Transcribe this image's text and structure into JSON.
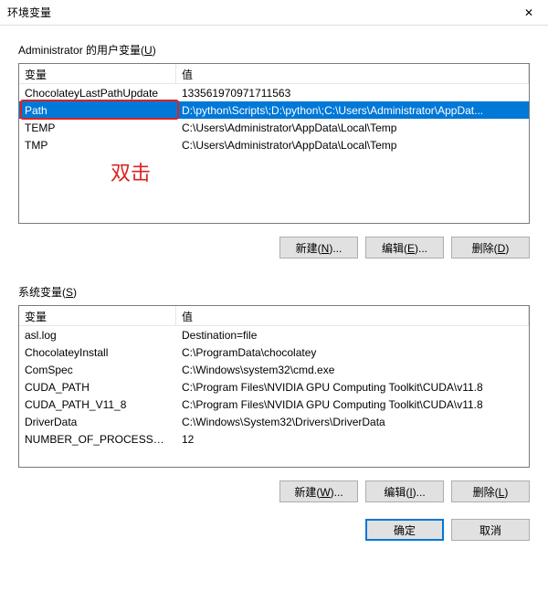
{
  "window": {
    "title": "环境变量"
  },
  "user_section": {
    "label_prefix": "Administrator 的用户变量(",
    "label_key": "U",
    "label_suffix": ")",
    "col_name": "变量",
    "col_value": "值",
    "rows": [
      {
        "name": "ChocolateyLastPathUpdate",
        "value": "133561970971711563"
      },
      {
        "name": "Path",
        "value": "D:\\python\\Scripts\\;D:\\python\\;C:\\Users\\Administrator\\AppDat..."
      },
      {
        "name": "TEMP",
        "value": "C:\\Users\\Administrator\\AppData\\Local\\Temp"
      },
      {
        "name": "TMP",
        "value": "C:\\Users\\Administrator\\AppData\\Local\\Temp"
      }
    ],
    "selected_index": 1,
    "btn_new": "新建(N)...",
    "btn_edit": "编辑(E)...",
    "btn_delete": "删除(D)"
  },
  "system_section": {
    "label_prefix": "系统变量(",
    "label_key": "S",
    "label_suffix": ")",
    "col_name": "变量",
    "col_value": "值",
    "rows": [
      {
        "name": "asl.log",
        "value": "Destination=file"
      },
      {
        "name": "ChocolateyInstall",
        "value": "C:\\ProgramData\\chocolatey"
      },
      {
        "name": "ComSpec",
        "value": "C:\\Windows\\system32\\cmd.exe"
      },
      {
        "name": "CUDA_PATH",
        "value": "C:\\Program Files\\NVIDIA GPU Computing Toolkit\\CUDA\\v11.8"
      },
      {
        "name": "CUDA_PATH_V11_8",
        "value": "C:\\Program Files\\NVIDIA GPU Computing Toolkit\\CUDA\\v11.8"
      },
      {
        "name": "DriverData",
        "value": "C:\\Windows\\System32\\Drivers\\DriverData"
      },
      {
        "name": "NUMBER_OF_PROCESSORS",
        "value": "12"
      }
    ],
    "btn_new": "新建(W)...",
    "btn_edit": "编辑(I)...",
    "btn_delete": "删除(L)"
  },
  "dialog": {
    "ok": "确定",
    "cancel": "取消"
  },
  "annotation": {
    "text": "双击"
  }
}
